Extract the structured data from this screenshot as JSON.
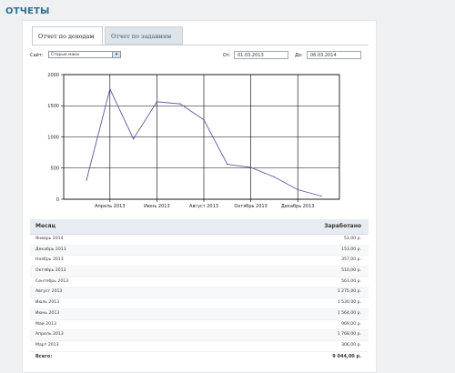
{
  "page": {
    "title": "ОТЧЕТЫ"
  },
  "tabs": [
    {
      "label": "Отчет по доходам",
      "active": true
    },
    {
      "label": "Отчет по заданиям",
      "active": false
    }
  ],
  "filters": {
    "site_label": "Сайт:",
    "site_value": "Старые маки",
    "from_label": "От:",
    "from_value": "01.03.2013",
    "to_label": "До:",
    "to_value": "06.03.2014"
  },
  "chart_data": {
    "type": "line",
    "x": [
      "Март 2013",
      "Апрель 2013",
      "Май 2013",
      "Июнь 2013",
      "Июль 2013",
      "Август 2013",
      "Сентябрь 2013",
      "Октябрь 2013",
      "Ноябрь 2013",
      "Декабрь 2013",
      "Январь 2014"
    ],
    "series": [
      {
        "values": [
          306,
          1768,
          969,
          1564,
          1530,
          1275,
          561,
          510,
          357,
          153,
          51
        ]
      }
    ],
    "xtick_labels": [
      "Апрель 2013",
      "Июнь 2013",
      "Август 2013",
      "Октябрь 2013",
      "Декабрь 2013"
    ],
    "ylim": [
      0,
      2000
    ],
    "yticks": [
      0,
      500,
      1000,
      1500,
      2000
    ],
    "grid": true,
    "line_color": "#5a5a9a"
  },
  "table": {
    "headers": {
      "month": "Месяц",
      "earned": "Заработано"
    },
    "rows": [
      {
        "month": "Январь 2014",
        "earned": "51,00 р."
      },
      {
        "month": "Декабрь 2013",
        "earned": "153,00 р."
      },
      {
        "month": "Ноябрь 2013",
        "earned": "357,00 р."
      },
      {
        "month": "Октябрь 2013",
        "earned": "510,00 р."
      },
      {
        "month": "Сентябрь 2013",
        "earned": "561,00 р."
      },
      {
        "month": "Август 2013",
        "earned": "1 275,00 р."
      },
      {
        "month": "Июль 2013",
        "earned": "1 530,00 р."
      },
      {
        "month": "Июнь 2013",
        "earned": "1 564,00 р."
      },
      {
        "month": "Май 2013",
        "earned": "969,00 р."
      },
      {
        "month": "Апрель 2013",
        "earned": "1 768,00 р."
      },
      {
        "month": "Март 2013",
        "earned": "306,00 р."
      }
    ],
    "total_label": "Всего:",
    "total_value": "9 044,00 р."
  }
}
